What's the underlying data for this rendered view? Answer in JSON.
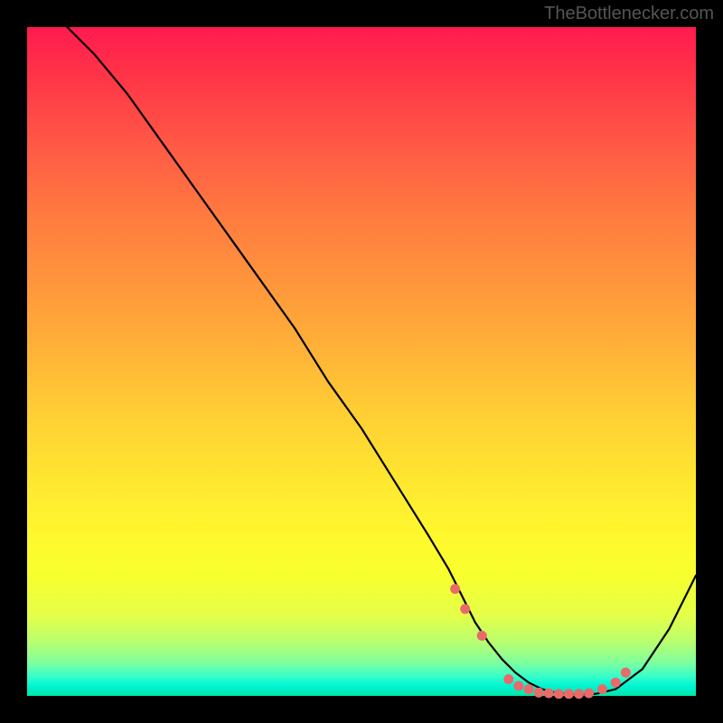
{
  "watermark": "TheBottlenecker.com",
  "chart_data": {
    "type": "line",
    "title": "",
    "xlabel": "",
    "ylabel": "",
    "xlim": [
      0,
      100
    ],
    "ylim": [
      0,
      100
    ],
    "series": [
      {
        "name": "bottleneck-curve",
        "x": [
          6,
          10,
          15,
          20,
          25,
          30,
          35,
          40,
          45,
          50,
          55,
          60,
          63,
          65,
          67,
          69,
          71,
          73,
          75,
          77,
          79,
          81,
          83,
          85,
          88,
          92,
          96,
          100
        ],
        "y": [
          100,
          96,
          90,
          83,
          76,
          69,
          62,
          55,
          47,
          40,
          32,
          24,
          19,
          15,
          11,
          8,
          5.5,
          3.5,
          2,
          1,
          0.5,
          0.3,
          0.2,
          0.3,
          1,
          4,
          10,
          18
        ]
      }
    ],
    "markers": {
      "name": "highlight-dots",
      "color": "#e86a6a",
      "points": [
        {
          "x": 64,
          "y": 16
        },
        {
          "x": 65.5,
          "y": 13
        },
        {
          "x": 68,
          "y": 9
        },
        {
          "x": 72,
          "y": 2.5
        },
        {
          "x": 73.5,
          "y": 1.5
        },
        {
          "x": 75,
          "y": 1
        },
        {
          "x": 76.5,
          "y": 0.5
        },
        {
          "x": 78,
          "y": 0.4
        },
        {
          "x": 79.5,
          "y": 0.3
        },
        {
          "x": 81,
          "y": 0.3
        },
        {
          "x": 82.5,
          "y": 0.3
        },
        {
          "x": 84,
          "y": 0.4
        },
        {
          "x": 86,
          "y": 1
        },
        {
          "x": 88,
          "y": 2
        },
        {
          "x": 89.5,
          "y": 3.5
        }
      ]
    },
    "gradient_colors": {
      "top": "#ff1a50",
      "mid_high": "#ff953c",
      "mid": "#ffe730",
      "mid_low": "#e4ff48",
      "bottom": "#00e5a8"
    }
  }
}
